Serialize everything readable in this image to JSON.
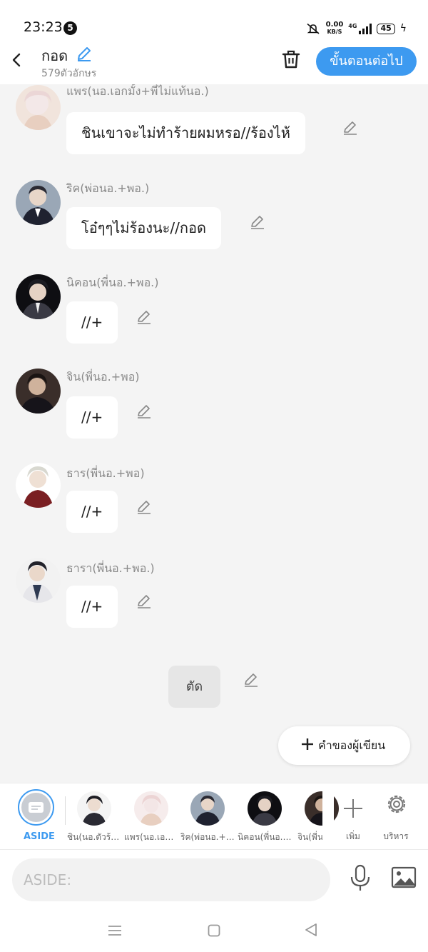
{
  "status_bar": {
    "time": "23:23",
    "notification_count": "5",
    "net_speed_value": "0.00",
    "net_speed_unit": "KB/S",
    "network_type": "4G",
    "battery": "45"
  },
  "header": {
    "title": "กอด",
    "char_count": "579ตัวอักษร",
    "next_label": "ขั้นตอนต่อไป"
  },
  "messages": [
    {
      "speaker": "แพร(นอ.เอกมั้ง+พี่ไม่แท้นอ.)",
      "text": "ชินเขาจะไม่ทำร้ายผมหรอ//ร้องไห้",
      "avatar_icon": "prae-avatar"
    },
    {
      "speaker": "ริค(พ่อนอ.+พอ.)",
      "text": "โอ๋ๆๆไม่ร้องนะ//กอด",
      "avatar_icon": "rick-avatar"
    },
    {
      "speaker": "นิคอน(พี่นอ.+พอ.)",
      "text": "//+",
      "avatar_icon": "nikon-avatar"
    },
    {
      "speaker": "จิน(พี่นอ.+พอ)",
      "text": "//+",
      "avatar_icon": "jin-avatar"
    },
    {
      "speaker": "ธาร(พี่นอ.+พอ)",
      "text": "//+",
      "avatar_icon": "than-avatar"
    },
    {
      "speaker": "ธารา(พี่นอ.+พอ.)",
      "text": "//+",
      "avatar_icon": "thara-avatar"
    }
  ],
  "cut_label": "ตัด",
  "author_words_label": "คำของผู้เขียน",
  "character_bar": {
    "aside_label": "ASIDE",
    "characters": [
      {
        "label": "ชิน(นอ.ตัวร้ายไม่ฆ่าคน)"
      },
      {
        "label": "แพร(นอ.เอกมั้ง+พี่ไม่แท้นอ.)"
      },
      {
        "label": "ริค(พ่อนอ.+พอ.)"
      },
      {
        "label": "นิคอน(พี่นอ.+พอ.)"
      },
      {
        "label": "จิน(พี่น"
      }
    ],
    "add_label": "เพิ่ม",
    "manage_label": "บริหาร"
  },
  "input": {
    "placeholder": "ASIDE:"
  },
  "colors": {
    "accent": "#3d9af0",
    "bubble": "#ffffff",
    "background": "#f4f4f4"
  }
}
